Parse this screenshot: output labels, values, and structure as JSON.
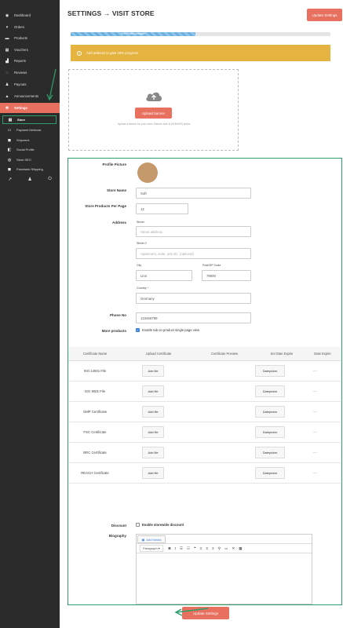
{
  "sidebar": {
    "items": [
      {
        "label": "Dashboard",
        "icon": "dashboard-icon",
        "glyph": "◉"
      },
      {
        "label": "Orders",
        "icon": "cart-icon",
        "glyph": "▾"
      },
      {
        "label": "Products",
        "icon": "box-icon",
        "glyph": "▬"
      },
      {
        "label": "Vouchers",
        "icon": "gift-icon",
        "glyph": "▦"
      },
      {
        "label": "Reports",
        "icon": "chart-icon",
        "glyph": "▟"
      },
      {
        "label": "Reviews",
        "icon": "comments-icon",
        "glyph": "◌"
      },
      {
        "label": "Payouts",
        "icon": "user-icon",
        "glyph": "♟"
      },
      {
        "label": "Announcements",
        "icon": "bell-icon",
        "glyph": "▲"
      },
      {
        "label": "Settings",
        "icon": "gear-icon",
        "glyph": "✱"
      }
    ],
    "subitems": [
      {
        "label": "Store",
        "icon": "bank-icon",
        "glyph": "▤"
      },
      {
        "label": "Payment Methods",
        "icon": "credit-card-icon",
        "glyph": "▭"
      },
      {
        "label": "Shipment",
        "icon": "truck-icon",
        "glyph": "◼"
      },
      {
        "label": "Social Profile",
        "icon": "share-icon",
        "glyph": "◧"
      },
      {
        "label": "Store SEO",
        "icon": "globe-icon",
        "glyph": "◍"
      },
      {
        "label": "Parcelado Shipping",
        "icon": "truck-icon",
        "glyph": "◼"
      }
    ],
    "bottom_icons": [
      {
        "name": "external-link-icon",
        "glyph": "↗"
      },
      {
        "name": "profile-icon",
        "glyph": "♟"
      },
      {
        "name": "power-icon",
        "glyph": "⏻"
      }
    ]
  },
  "header": {
    "title": "SETTINGS → VISIT STORE",
    "update_label": "Update Settings"
  },
  "progress": {
    "label": "15% Profile complete",
    "percent": 15
  },
  "alert": {
    "text": "Add address  to gain 25% progress"
  },
  "banner": {
    "upload_label": "Upload banner",
    "hint": "Upload a banner for your store. Banner size is (625x300) pixels."
  },
  "form": {
    "profile_picture_label": "Profile Picture",
    "store_name_label": "Store Name",
    "store_name_value": "Soft",
    "products_per_page_label": "Store Products Per Page",
    "products_per_page_value": "12",
    "address_label": "Address",
    "street_label": "Street",
    "street_placeholder": "Street address",
    "street2_label": "Street 2",
    "street2_placeholder": "Apartment, suite, unit etc. (optional)",
    "city_label": "City",
    "city_value": "Linn",
    "zip_label": "Post/ZIP Code",
    "zip_value": "79000",
    "country_label": "Country",
    "country_required": "*",
    "country_value": "Germany",
    "phone_label": "Phone No",
    "phone_value": "123456789",
    "more_products_label": "More products",
    "more_products_text": "Enable tab on product single page view",
    "more_products_checked": true,
    "discount_label": "Discount",
    "discount_text": "Enable storewide discount",
    "discount_checked": false,
    "biography_label": "Biography",
    "add_media_label": "Add Media"
  },
  "certificates": {
    "headers": [
      "Certificate Name",
      "Upload Certificate",
      "Certificate Preview",
      "Set Date Expire",
      "Date Expire"
    ],
    "add_file_label": "Add file",
    "datepicker_label": "Datepicker",
    "empty_value": "---",
    "rows": [
      "ISO 14001 File",
      "ISO 9001 File",
      "GMP Certificate",
      "FSC Certificate",
      "BRC Certificate",
      "REACH Certificate"
    ]
  },
  "editor_toolbar": {
    "paragraph": "Paragraph",
    "tools": [
      "B",
      "I",
      "☰",
      "☷",
      "❝",
      "≡",
      "≡",
      "≡",
      "⚲",
      "▭",
      "✕",
      "▦"
    ]
  },
  "footer": {
    "update_label": "Update Settings"
  },
  "colors": {
    "accent": "#e8705f",
    "sidebar_bg": "#2b2b2b",
    "highlight": "#2e9e6b",
    "alert": "#e5b33f"
  }
}
